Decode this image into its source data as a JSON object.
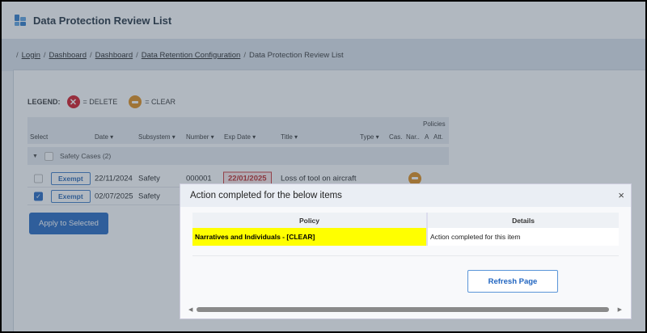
{
  "header": {
    "title": "Data Protection Review List"
  },
  "breadcrumb": [
    "Login",
    "Dashboard",
    "Dashboard",
    "Data Retention Configuration"
  ],
  "breadcrumb_current": "Data Protection Review List",
  "legend": {
    "label": "LEGEND:",
    "delete": "= DELETE",
    "clear": "= CLEAR"
  },
  "table": {
    "policies": "Policies",
    "cols": [
      "Select",
      "Date ▾",
      "Subsystem ▾",
      "Number ▾",
      "Exp Date ▾",
      "Title ▾",
      "Type ▾",
      "Cas.",
      "Nar..",
      "A",
      "Att."
    ],
    "group": "Safety Cases (2)",
    "rows": [
      {
        "exempt": "Exempt",
        "date": "22/11/2024",
        "subsystem": "Safety",
        "number": "000001",
        "exp": "22/01/2025",
        "title": "Loss of tool on aircraft",
        "checked": false
      },
      {
        "exempt": "Exempt",
        "date": "02/07/2025",
        "subsystem": "Safety",
        "checked": true
      }
    ]
  },
  "apply": "Apply to Selected",
  "modal": {
    "title": "Action completed for the below items",
    "close": "×",
    "col_policy": "Policy",
    "col_details": "Details",
    "policy": "Narratives and Individuals - [CLEAR]",
    "details": "Action completed for this item",
    "refresh": "Refresh Page"
  },
  "colors": {
    "accent": "#1f64c0",
    "delete": "#d3121e",
    "clear": "#e08a14",
    "highlight": "#ffff00"
  }
}
